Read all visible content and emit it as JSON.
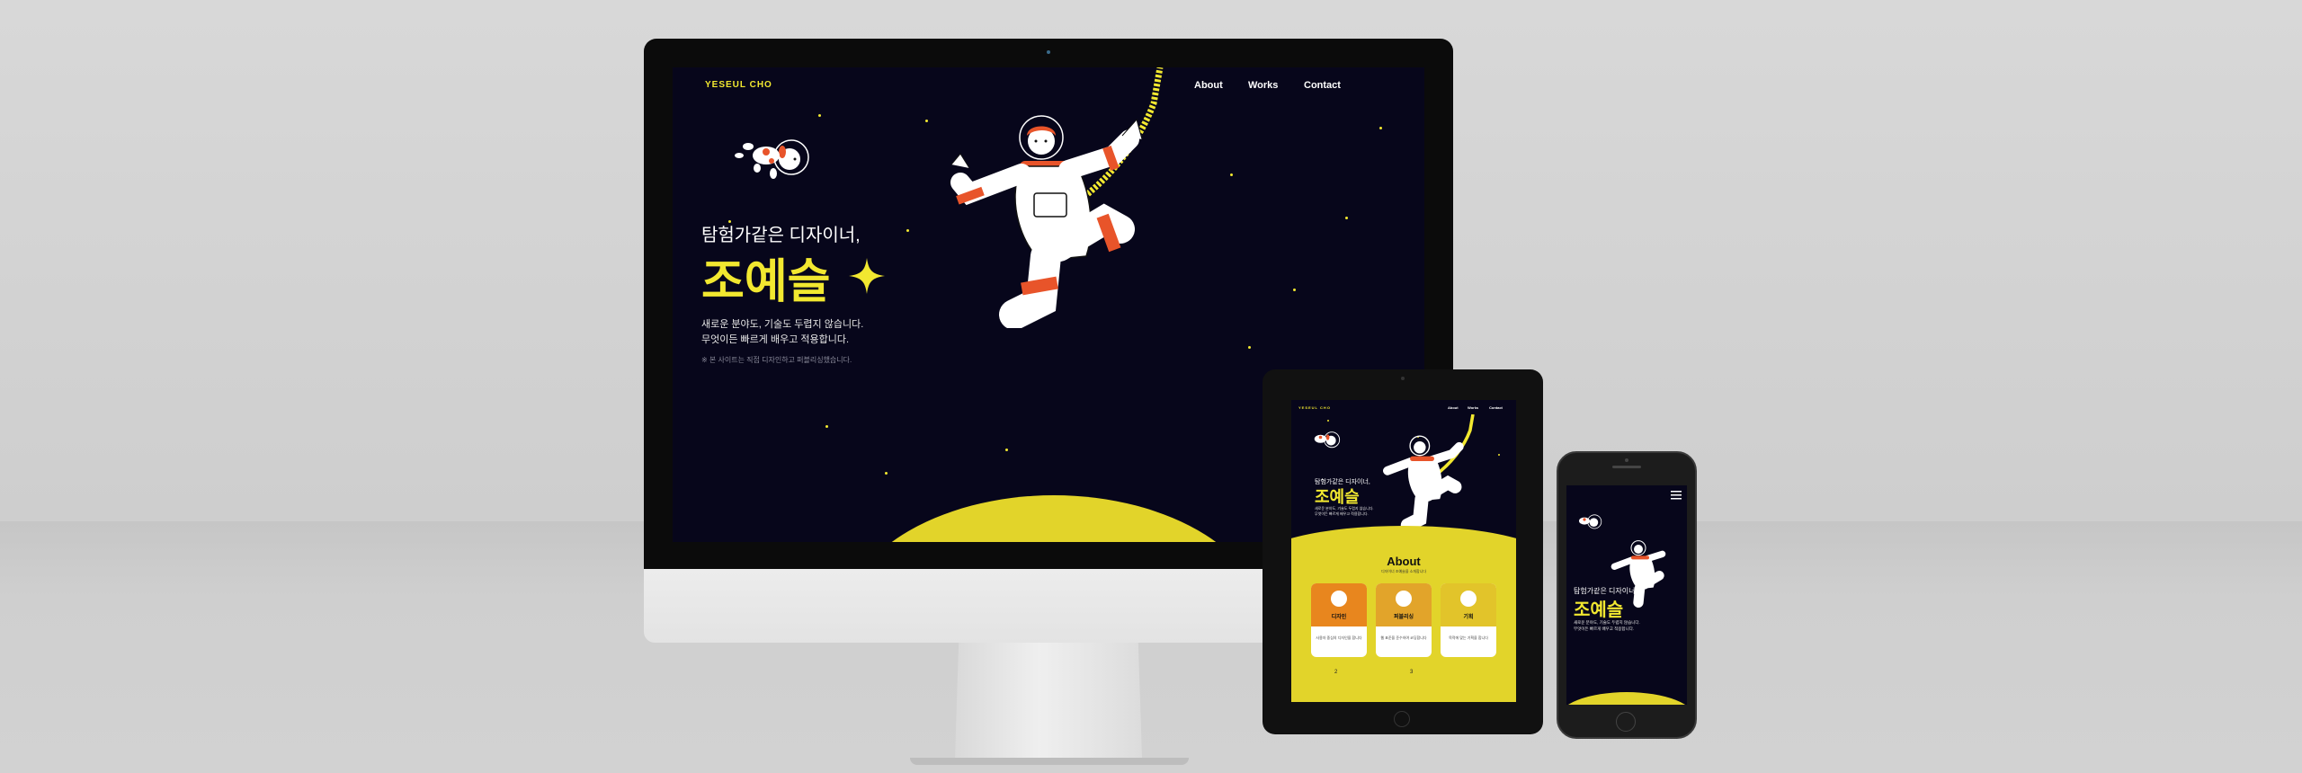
{
  "site": {
    "logo": "YESEUL CHO",
    "nav": [
      "About",
      "Works",
      "Contact"
    ],
    "hero": {
      "subtitle": "탐험가같은 디자이너,",
      "name": "조예슬",
      "body_line1": "새로운 분야도, 기술도 두렵지 않습니다.",
      "body_line2": "무엇이든 빠르게 배우고 적용합니다.",
      "note": "※ 본 사이트는 직접 디자인하고 퍼블리싱했습니다."
    },
    "about": {
      "title": "About",
      "subtitle": "디자이너 조예슬을 소개합니다",
      "cards": [
        {
          "title": "디자인",
          "text": "사용자 중심의 디자인을 합니다",
          "color": "#e8861e"
        },
        {
          "title": "퍼블리싱",
          "text": "웹 표준을 준수하여 코딩합니다",
          "color": "#e2a42a"
        },
        {
          "title": "기획",
          "text": "목적에 맞는 기획을 합니다",
          "color": "#e2c42a"
        }
      ],
      "stats": [
        "2",
        "3"
      ]
    }
  },
  "colors": {
    "background": "#07061b",
    "accent": "#f2e830",
    "planet": "#e2d42a",
    "suit_orange": "#e8542a"
  }
}
